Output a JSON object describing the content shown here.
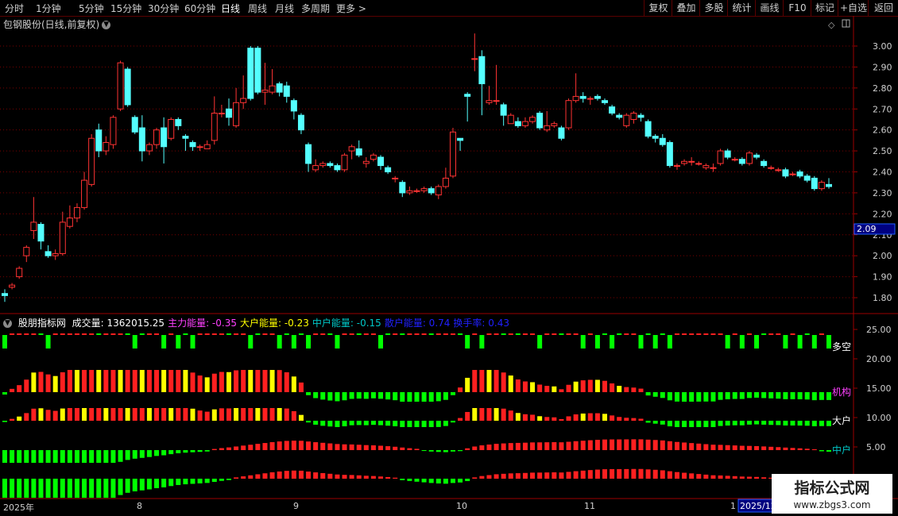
{
  "toolbar": {
    "periods": [
      "分时",
      "1分钟",
      "5分钟",
      "15分钟",
      "30分钟",
      "60分钟",
      "日线",
      "周线",
      "月线",
      "多周期",
      "更多 >"
    ],
    "active_period": "日线",
    "right_buttons": [
      "复权",
      "叠加",
      "多股",
      "统计",
      "画线",
      "F10",
      "标记",
      "+自选",
      "返回"
    ]
  },
  "stock": {
    "title": "包钢股份(日线,前复权)"
  },
  "price_axis": {
    "ticks": [
      "3.00",
      "2.90",
      "2.80",
      "2.70",
      "2.60",
      "2.50",
      "2.40",
      "2.30",
      "2.20",
      "2.10",
      "2.00",
      "1.90",
      "1.80"
    ],
    "current_price": "2.09"
  },
  "indicator": {
    "name": "股朋指标网",
    "items": [
      {
        "label": "成交量: 1362015.25",
        "color": "#ffffff"
      },
      {
        "label": "主力能量: -0.35",
        "color": "#ff40ff"
      },
      {
        "label": "大户能量: -0.23",
        "color": "#ffff00"
      },
      {
        "label": "中户能量: -0.15",
        "color": "#00c8c8"
      },
      {
        "label": "散户能量: 0.74",
        "color": "#2020ff"
      },
      {
        "label": "换手率: 0.43",
        "color": "#2020ff"
      }
    ],
    "axis_ticks": [
      "25.00",
      "20.00",
      "15.00",
      "10.00",
      "5.00"
    ],
    "line_labels": [
      {
        "text": "多空",
        "color": "#ffffff"
      },
      {
        "text": "机构",
        "color": "#ff40ff"
      },
      {
        "text": "大户",
        "color": "#ffffff"
      },
      {
        "text": "中户",
        "color": "#00c8c8"
      }
    ]
  },
  "x_axis": {
    "labels": [
      "2025年",
      "8",
      "9",
      "10",
      "11",
      "1"
    ],
    "current_date": "2025/12"
  },
  "watermark": {
    "title": "指标公式网",
    "url": "www.zbgs3.com"
  },
  "colors": {
    "up": "#ff3333",
    "down": "#54ffff",
    "grid": "#7a0000",
    "green": "#00ff00",
    "yellow": "#ffff00",
    "red": "#ff2020"
  },
  "chart_data": {
    "type": "candlestick",
    "title": "包钢股份(日线,前复权)",
    "ylim": [
      1.75,
      3.07
    ],
    "candles": [
      [
        1.82,
        1.81,
        1.78,
        1.84
      ],
      [
        1.85,
        1.86,
        1.84,
        1.87
      ],
      [
        1.9,
        1.94,
        1.89,
        1.95
      ],
      [
        2.0,
        2.04,
        1.97,
        2.05
      ],
      [
        2.12,
        2.16,
        2.08,
        2.28
      ],
      [
        2.15,
        2.07,
        2.03,
        2.16
      ],
      [
        2.02,
        2.0,
        1.99,
        2.05
      ],
      [
        2.0,
        2.01,
        1.98,
        2.03
      ],
      [
        2.01,
        2.16,
        2.0,
        2.21
      ],
      [
        2.14,
        2.18,
        2.13,
        2.24
      ],
      [
        2.18,
        2.23,
        2.16,
        2.25
      ],
      [
        2.23,
        2.36,
        2.22,
        2.4
      ],
      [
        2.34,
        2.56,
        2.33,
        2.58
      ],
      [
        2.6,
        2.5,
        2.47,
        2.63
      ],
      [
        2.5,
        2.54,
        2.48,
        2.57
      ],
      [
        2.53,
        2.66,
        2.51,
        2.67
      ],
      [
        2.7,
        2.92,
        2.69,
        2.93
      ],
      [
        2.89,
        2.72,
        2.71,
        2.9
      ],
      [
        2.66,
        2.59,
        2.58,
        2.67
      ],
      [
        2.61,
        2.5,
        2.45,
        2.67
      ],
      [
        2.5,
        2.53,
        2.48,
        2.54
      ],
      [
        2.53,
        2.6,
        2.51,
        2.61
      ],
      [
        2.61,
        2.52,
        2.44,
        2.66
      ],
      [
        2.56,
        2.65,
        2.55,
        2.66
      ],
      [
        2.65,
        2.62,
        2.6,
        2.66
      ],
      [
        2.57,
        2.56,
        2.5,
        2.58
      ],
      [
        2.54,
        2.52,
        2.5,
        2.55
      ],
      [
        2.52,
        2.52,
        2.5,
        2.53
      ],
      [
        2.51,
        2.53,
        2.51,
        2.55
      ],
      [
        2.55,
        2.68,
        2.53,
        2.76
      ],
      [
        2.68,
        2.68,
        2.66,
        2.72
      ],
      [
        2.7,
        2.66,
        2.62,
        2.75
      ],
      [
        2.62,
        2.73,
        2.61,
        2.8
      ],
      [
        2.73,
        2.75,
        2.7,
        2.86
      ],
      [
        2.99,
        2.75,
        2.74,
        3.0
      ],
      [
        2.99,
        2.78,
        2.77,
        3.0
      ],
      [
        2.78,
        2.79,
        2.72,
        2.92
      ],
      [
        2.78,
        2.81,
        2.77,
        2.89
      ],
      [
        2.82,
        2.78,
        2.76,
        2.83
      ],
      [
        2.81,
        2.76,
        2.73,
        2.83
      ],
      [
        2.74,
        2.69,
        2.65,
        2.75
      ],
      [
        2.67,
        2.6,
        2.58,
        2.68
      ],
      [
        2.53,
        2.44,
        2.4,
        2.54
      ],
      [
        2.41,
        2.43,
        2.4,
        2.46
      ],
      [
        2.43,
        2.44,
        2.42,
        2.45
      ],
      [
        2.44,
        2.43,
        2.42,
        2.45
      ],
      [
        2.43,
        2.41,
        2.4,
        2.44
      ],
      [
        2.41,
        2.48,
        2.4,
        2.49
      ],
      [
        2.5,
        2.52,
        2.46,
        2.53
      ],
      [
        2.51,
        2.48,
        2.47,
        2.55
      ],
      [
        2.44,
        2.45,
        2.42,
        2.47
      ],
      [
        2.46,
        2.48,
        2.45,
        2.49
      ],
      [
        2.47,
        2.43,
        2.41,
        2.48
      ],
      [
        2.42,
        2.4,
        2.39,
        2.43
      ],
      [
        2.37,
        2.37,
        2.35,
        2.38
      ],
      [
        2.35,
        2.3,
        2.28,
        2.36
      ],
      [
        2.3,
        2.31,
        2.29,
        2.33
      ],
      [
        2.31,
        2.31,
        2.3,
        2.32
      ],
      [
        2.31,
        2.32,
        2.3,
        2.33
      ],
      [
        2.32,
        2.3,
        2.29,
        2.33
      ],
      [
        2.29,
        2.33,
        2.27,
        2.34
      ],
      [
        2.33,
        2.37,
        2.32,
        2.42
      ],
      [
        2.38,
        2.59,
        2.37,
        2.61
      ],
      [
        2.56,
        2.55,
        2.5,
        2.56
      ],
      [
        2.77,
        2.76,
        2.64,
        2.78
      ],
      [
        2.94,
        2.94,
        2.88,
        3.06
      ],
      [
        2.95,
        2.82,
        2.67,
        2.98
      ],
      [
        2.73,
        2.74,
        2.72,
        2.81
      ],
      [
        2.74,
        2.74,
        2.72,
        2.91
      ],
      [
        2.72,
        2.67,
        2.62,
        2.73
      ],
      [
        2.63,
        2.67,
        2.63,
        2.68
      ],
      [
        2.64,
        2.62,
        2.61,
        2.66
      ],
      [
        2.62,
        2.64,
        2.61,
        2.66
      ],
      [
        2.64,
        2.66,
        2.63,
        2.67
      ],
      [
        2.68,
        2.61,
        2.6,
        2.69
      ],
      [
        2.6,
        2.62,
        2.59,
        2.69
      ],
      [
        2.62,
        2.63,
        2.61,
        2.64
      ],
      [
        2.61,
        2.56,
        2.55,
        2.62
      ],
      [
        2.61,
        2.74,
        2.6,
        2.75
      ],
      [
        2.74,
        2.76,
        2.73,
        2.87
      ],
      [
        2.76,
        2.75,
        2.73,
        2.78
      ],
      [
        2.75,
        2.75,
        2.72,
        2.76
      ],
      [
        2.76,
        2.75,
        2.74,
        2.77
      ],
      [
        2.74,
        2.73,
        2.72,
        2.75
      ],
      [
        2.71,
        2.68,
        2.67,
        2.72
      ],
      [
        2.67,
        2.66,
        2.65,
        2.68
      ],
      [
        2.62,
        2.67,
        2.61,
        2.68
      ],
      [
        2.65,
        2.68,
        2.63,
        2.69
      ],
      [
        2.67,
        2.66,
        2.64,
        2.68
      ],
      [
        2.64,
        2.57,
        2.56,
        2.65
      ],
      [
        2.57,
        2.56,
        2.54,
        2.58
      ],
      [
        2.56,
        2.53,
        2.52,
        2.58
      ],
      [
        2.54,
        2.43,
        2.42,
        2.55
      ],
      [
        2.43,
        2.43,
        2.41,
        2.44
      ],
      [
        2.44,
        2.45,
        2.43,
        2.46
      ],
      [
        2.45,
        2.45,
        2.43,
        2.47
      ],
      [
        2.44,
        2.44,
        2.43,
        2.45
      ],
      [
        2.42,
        2.43,
        2.41,
        2.44
      ],
      [
        2.42,
        2.42,
        2.4,
        2.44
      ],
      [
        2.44,
        2.5,
        2.43,
        2.51
      ],
      [
        2.5,
        2.47,
        2.46,
        2.51
      ],
      [
        2.46,
        2.46,
        2.45,
        2.47
      ],
      [
        2.46,
        2.44,
        2.43,
        2.47
      ],
      [
        2.44,
        2.49,
        2.43,
        2.5
      ],
      [
        2.48,
        2.47,
        2.46,
        2.49
      ],
      [
        2.45,
        2.43,
        2.42,
        2.46
      ],
      [
        2.42,
        2.42,
        2.41,
        2.43
      ],
      [
        2.41,
        2.41,
        2.4,
        2.42
      ],
      [
        2.41,
        2.38,
        2.37,
        2.42
      ],
      [
        2.39,
        2.39,
        2.38,
        2.4
      ],
      [
        2.4,
        2.38,
        2.37,
        2.41
      ],
      [
        2.38,
        2.36,
        2.35,
        2.39
      ],
      [
        2.37,
        2.32,
        2.31,
        2.38
      ],
      [
        2.32,
        2.35,
        2.31,
        2.36
      ],
      [
        2.34,
        2.33,
        2.32,
        2.37
      ]
    ]
  }
}
